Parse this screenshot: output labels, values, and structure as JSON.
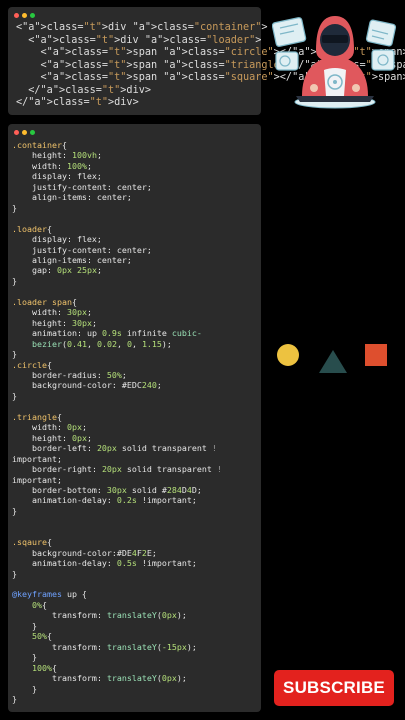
{
  "colors": {
    "circle": "#EDC240",
    "triangle": "#284D4D",
    "square": "#DE4F2E",
    "window_bg": "#2b2b2b",
    "dot_red": "#ff5f57",
    "dot_yellow": "#febc2e",
    "dot_green": "#28c840",
    "subscribe_bg": "#e3221e"
  },
  "icons": [
    "hacker-illustration-icon",
    "window-close-dot-icon",
    "window-minimize-dot-icon",
    "window-zoom-dot-icon"
  ],
  "html_code": {
    "lines": [
      "<div class=\"container\">",
      "  <div class=\"loader\">",
      "    <span class=\"circle\"></span>",
      "    <span class=\"triangle\"></span>",
      "    <span class=\"square\"></span>",
      "  </div>",
      "</div>"
    ]
  },
  "css_code": {
    "lines": [
      ".container{",
      "    height: 100vh;",
      "    width: 100%;",
      "    display: flex;",
      "    justify-content: center;",
      "    align-items: center;",
      "}",
      "",
      ".loader{",
      "    display: flex;",
      "    justify-content: center;",
      "    align-items: center;",
      "    gap: 0px 25px;",
      "}",
      "",
      ".loader span{",
      "    width: 30px;",
      "    height: 30px;",
      "    animation: up 0.9s infinite cubic-",
      "    bezier(0.41, 0.02, 0, 1.15);",
      "}",
      ".circle{",
      "    border-radius: 50%;",
      "    background-color: #EDC240;",
      "}",
      "",
      ".triangle{",
      "    width: 0px;",
      "    height: 0px;",
      "    border-left: 20px solid transparent !",
      "important;",
      "    border-right: 20px solid transparent !",
      "important;",
      "    border-bottom: 30px solid #284D4D;",
      "    animation-delay: 0.2s !important;",
      "}",
      "",
      "",
      ".sqaure{",
      "    background-color:#DE4F2E;",
      "    animation-delay: 0.5s !important;",
      "}",
      "",
      "@keyframes up {",
      "    0%{",
      "        transform: translateY(0px);",
      "    }",
      "    50%{",
      "        transform: translateY(-15px);",
      "    }",
      "    100%{",
      "        transform: translateY(0px);",
      "    }",
      "}"
    ]
  },
  "subscribe": {
    "label": "SUBSCRIBE"
  }
}
